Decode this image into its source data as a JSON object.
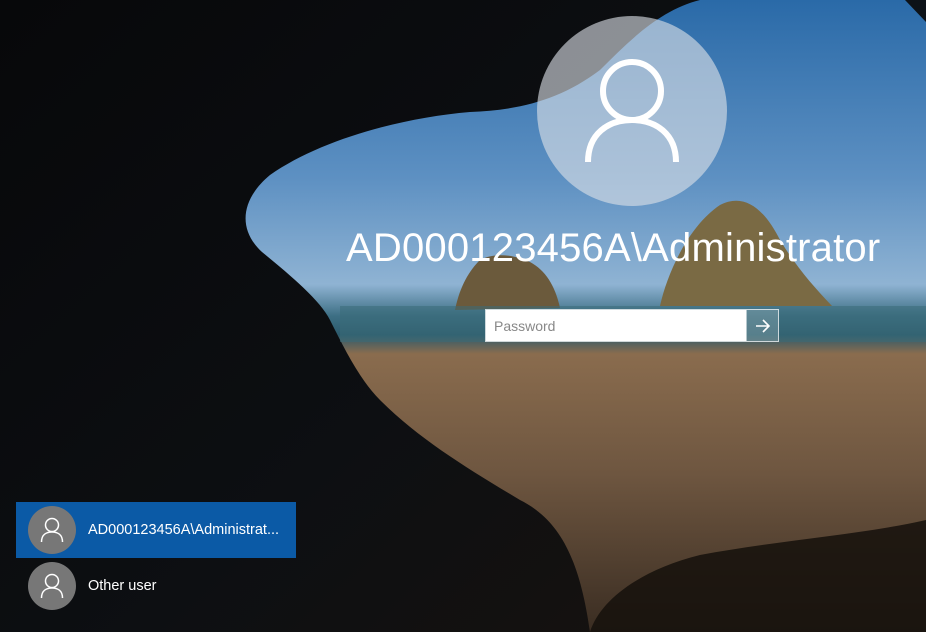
{
  "login": {
    "username": "AD000123456A\\Administrator",
    "password_placeholder": "Password"
  },
  "user_list": [
    {
      "label": "AD000123456A\\Administrat...",
      "selected": true
    },
    {
      "label": "Other user",
      "selected": false
    }
  ],
  "icons": {
    "avatar": "user-silhouette-icon",
    "submit": "arrow-right-icon"
  },
  "colors": {
    "selected_user_bg": "#0b5aa6",
    "text": "#ffffff"
  }
}
